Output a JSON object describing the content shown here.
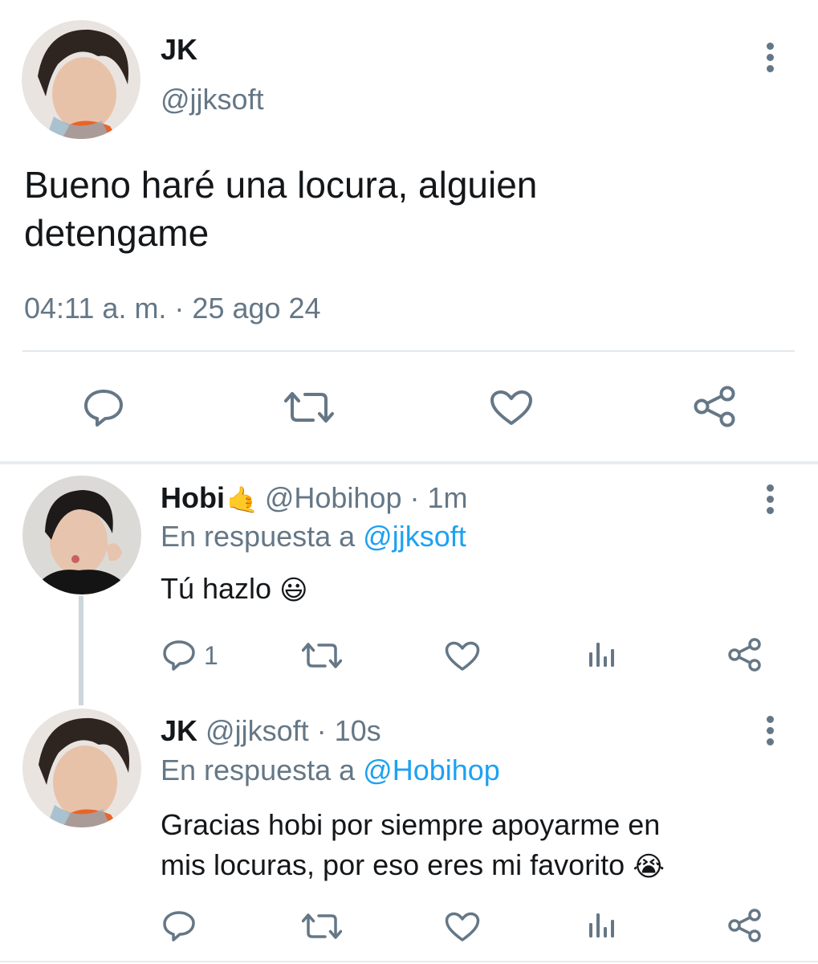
{
  "main_tweet": {
    "display_name": "JK",
    "handle": "@jjksoft",
    "text_line1": "Bueno haré una locura, alguien",
    "text_line2": "detengame",
    "timestamp": "04:11 a. m. · 25 ago 24",
    "actions": [
      "reply-icon",
      "retweet-icon",
      "like-icon",
      "share-icon"
    ]
  },
  "replies": [
    {
      "display_name": "Hobi",
      "name_emoji": "🤙",
      "handle": "@Hobihop",
      "time": " · 1m",
      "reply_prefix": "En respuesta a ",
      "reply_to": "@jjksoft",
      "text": "Tú hazlo ",
      "text_emoji": "😃",
      "reply_count": "1"
    },
    {
      "display_name": "JK",
      "handle": "@jjksoft",
      "time": " · 10s",
      "reply_prefix": "En respuesta a ",
      "reply_to": "@Hobihop",
      "text_line1": "Gracias hobi por siempre apoyarme en",
      "text_line2": "mis locuras, por eso eres mi favorito ",
      "text_emoji": "😭",
      "reply_count": ""
    }
  ],
  "colors": {
    "text": "#14171a",
    "muted": "#657786",
    "link": "#1da1f2",
    "divider": "#e1e8ed",
    "thread_line": "#ccd6dd"
  }
}
